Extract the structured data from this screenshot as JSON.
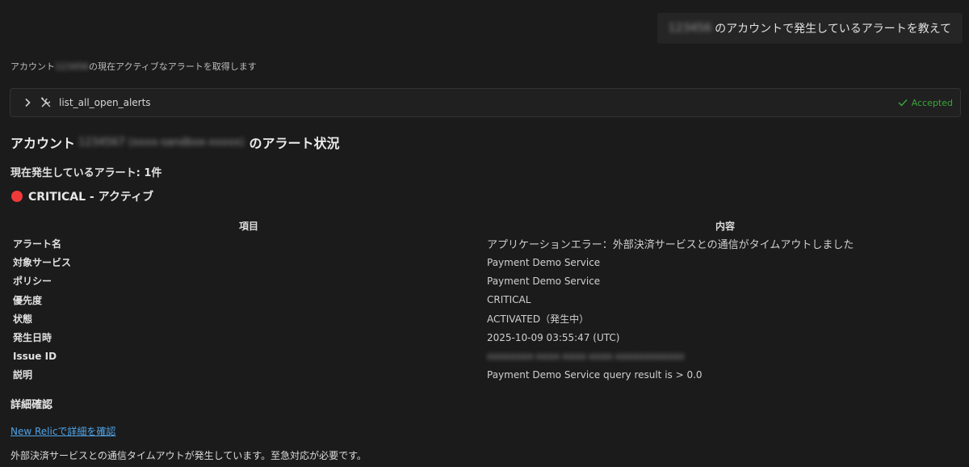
{
  "user_message": {
    "redacted_account": "123456",
    "text": "のアカウントで発生しているアラートを教えて"
  },
  "assistant_status": {
    "prefix": "アカウント",
    "redacted": "123456",
    "suffix": "の現在アクティブなアラートを取得します"
  },
  "tool_call": {
    "name": "list_all_open_alerts",
    "status": "Accepted"
  },
  "heading": {
    "prefix": "アカウント",
    "redacted": "1234567 (xxxx-sandbox-xxxxx)",
    "suffix": "のアラート状況"
  },
  "alert_count": "現在発生しているアラート: 1件",
  "severity_heading": "CRITICAL - アクティブ",
  "table": {
    "headers": [
      "項目",
      "内容"
    ],
    "rows": [
      {
        "key": "アラート名",
        "value": "アプリケーションエラー：外部決済サービスとの通信がタイムアウトしました"
      },
      {
        "key": "対象サービス",
        "value": "Payment Demo Service"
      },
      {
        "key": "ポリシー",
        "value": "Payment Demo Service"
      },
      {
        "key": "優先度",
        "value": "CRITICAL"
      },
      {
        "key": "状態",
        "value": "ACTIVATED（発生中）"
      },
      {
        "key": "発生日時",
        "value": "2025-10-09 03:55:47 (UTC)"
      },
      {
        "key": "Issue ID",
        "value": "xxxxxxxx-xxxx-xxxx-xxxx-xxxxxxxxxxxx"
      },
      {
        "key": "説明",
        "value": "Payment Demo Service query result is > 0.0"
      }
    ]
  },
  "details_heading": "詳細確認",
  "details_link": "New Relicで詳細を確認",
  "footer": "外部決済サービスとの通信タイムアウトが発生しています。至急対応が必要です。",
  "colors": {
    "background": "#1b1b1b",
    "accepted": "#39a839",
    "critical_dot": "#f03a3a",
    "link": "#4fa3e8"
  },
  "icons": {
    "chevron": "chevron-right-icon",
    "tools": "tools-icon",
    "accepted": "check-icon",
    "severity": "red-circle-icon"
  }
}
